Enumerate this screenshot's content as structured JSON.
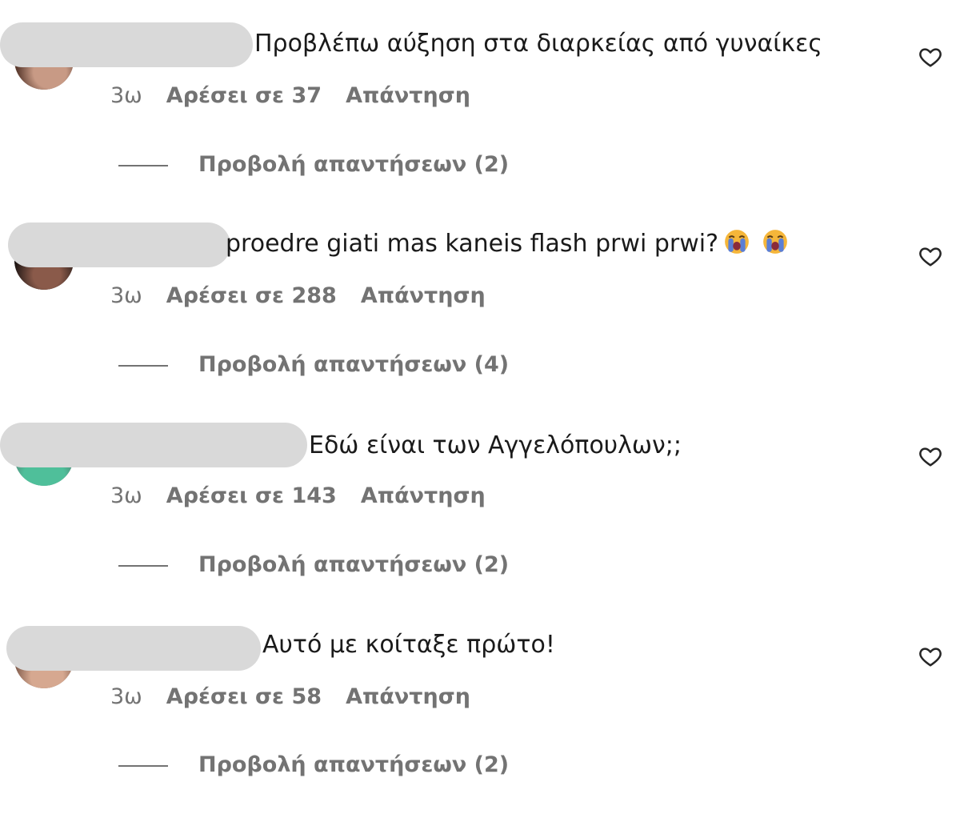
{
  "comments": [
    {
      "text": "Προβλέπω αύξηση στα διαρκείας από γυναίκες",
      "time": "3ω",
      "likes": "Αρέσει σε 37",
      "reply": "Απάντηση",
      "view_replies": "Προβολή απαντήσεων (2)",
      "emojis": []
    },
    {
      "text": "proedre giati mas kaneis flash prwi prwi?",
      "time": "3ω",
      "likes": "Αρέσει σε 288",
      "reply": "Απάντηση",
      "view_replies": "Προβολή απαντήσεων (4)",
      "emojis": [
        "loudly-crying-face",
        "loudly-crying-face"
      ]
    },
    {
      "text": "Εδώ είναι των Αγγελόπουλων;;",
      "time": "3ω",
      "likes": "Αρέσει σε 143",
      "reply": "Απάντηση",
      "view_replies": "Προβολή απαντήσεων (2)",
      "emojis": []
    },
    {
      "text": "Αυτό με κοίταξε πρώτο!",
      "time": "3ω",
      "likes": "Αρέσει σε 58",
      "reply": "Απάντηση",
      "view_replies": "Προβολή απαντήσεων (2)",
      "emojis": []
    }
  ],
  "icons": {
    "like": "heart-outline-icon",
    "emoji": "loudly-crying-face-emoji"
  },
  "colors": {
    "text": "#1a1a1a",
    "secondary": "#737373",
    "mask": "#d9d9d9",
    "emoji_face": "#f5b63a",
    "emoji_tears": "#5b7fd6"
  }
}
